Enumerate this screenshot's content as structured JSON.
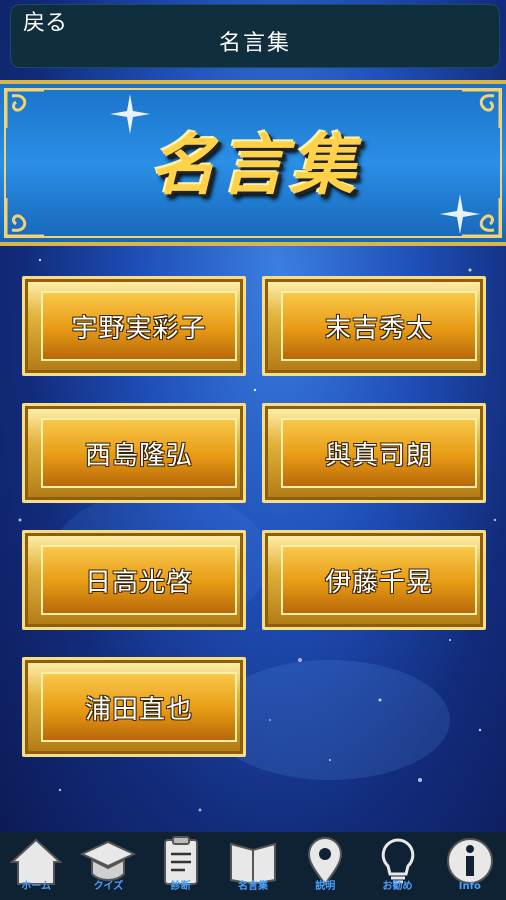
{
  "header": {
    "back_label": "戻る",
    "title": "名言集"
  },
  "banner": {
    "title": "名言集"
  },
  "names": [
    "宇野実彩子",
    "末吉秀太",
    "西島隆弘",
    "與真司朗",
    "日高光啓",
    "伊藤千晃",
    "浦田直也"
  ],
  "tabs": [
    {
      "label": "ホーム",
      "icon": "home-icon"
    },
    {
      "label": "クイズ",
      "icon": "graduation-cap-icon"
    },
    {
      "label": "診断",
      "icon": "clipboard-icon"
    },
    {
      "label": "名言集",
      "icon": "book-icon"
    },
    {
      "label": "説明",
      "icon": "map-pin-icon"
    },
    {
      "label": "お勧め",
      "icon": "lightbulb-icon"
    },
    {
      "label": "Info",
      "icon": "info-icon"
    }
  ],
  "colors": {
    "gold": "#e2b23a",
    "background": "#1f4fb8",
    "tabbar": "#0f2233",
    "tab_label": "#4aa0ff"
  }
}
